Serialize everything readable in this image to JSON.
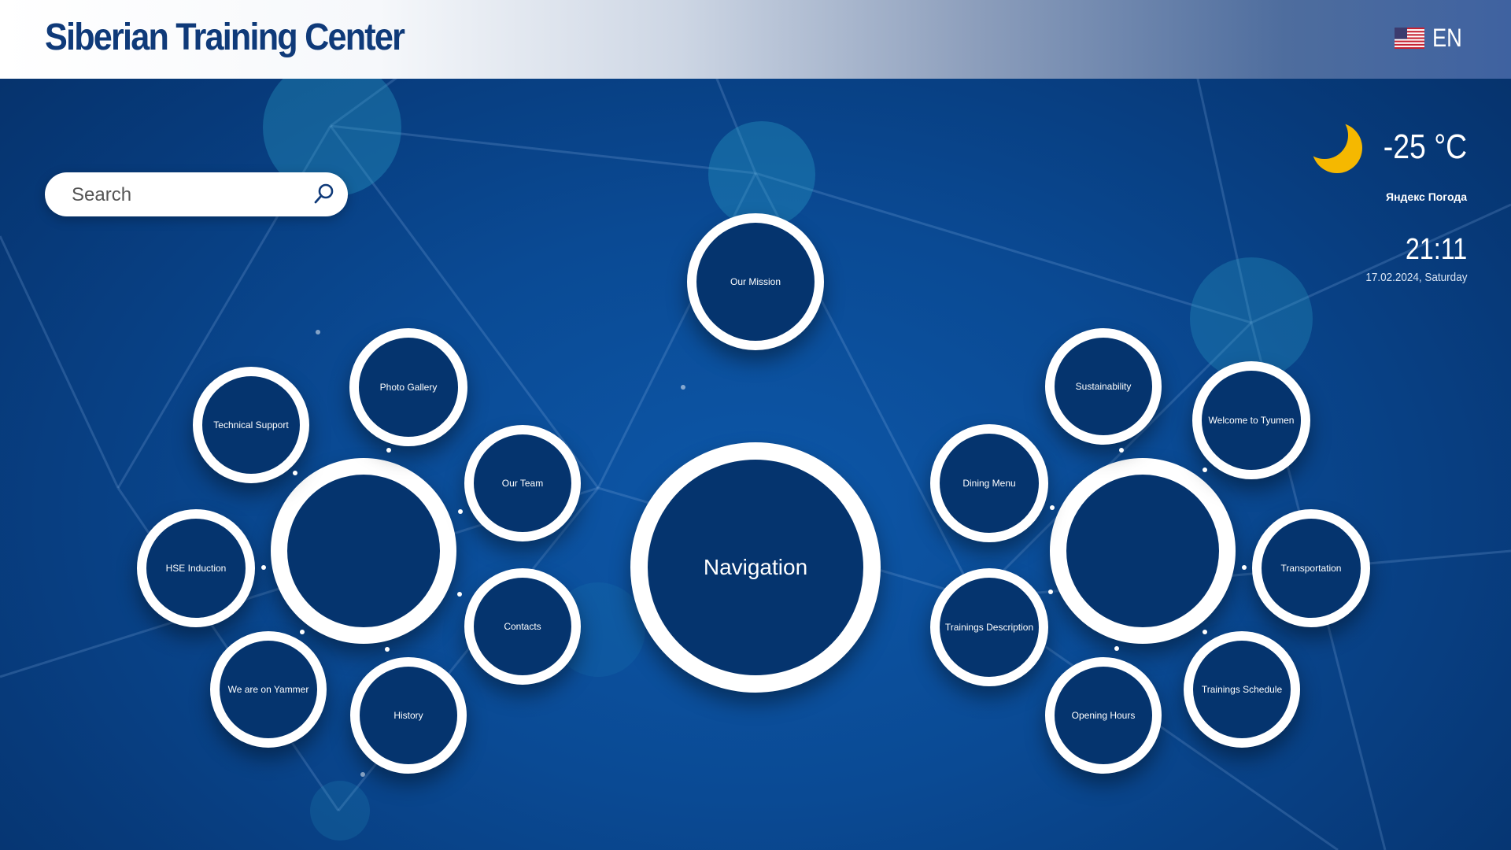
{
  "header": {
    "title": "Siberian Training Center",
    "language": "EN"
  },
  "search": {
    "placeholder": "Search"
  },
  "weather": {
    "temperature": "-25 °C",
    "provider": "Яндекс Погода",
    "icon": "moon-icon"
  },
  "clock": {
    "time": "21:11",
    "date": "17.02.2024, Saturday"
  },
  "navigation": {
    "center_label": "Navigation",
    "top_label": "Our Mission",
    "left_group": [
      "Photo Gallery",
      "Technical Support",
      "Our Team",
      "HSE Induction",
      "Contacts",
      "We are on Yammer",
      "History"
    ],
    "right_group": [
      "Sustainability",
      "Welcome to Tyumen",
      "Dining Menu",
      "Transportation",
      "Trainings Description",
      "Trainings Schedule",
      "Opening Hours"
    ]
  },
  "colors": {
    "background": "#0a4a94",
    "title": "#0f3a79",
    "node_fill": "#05346e",
    "node_ring": "#ffffff",
    "moon": "#f5b800"
  }
}
